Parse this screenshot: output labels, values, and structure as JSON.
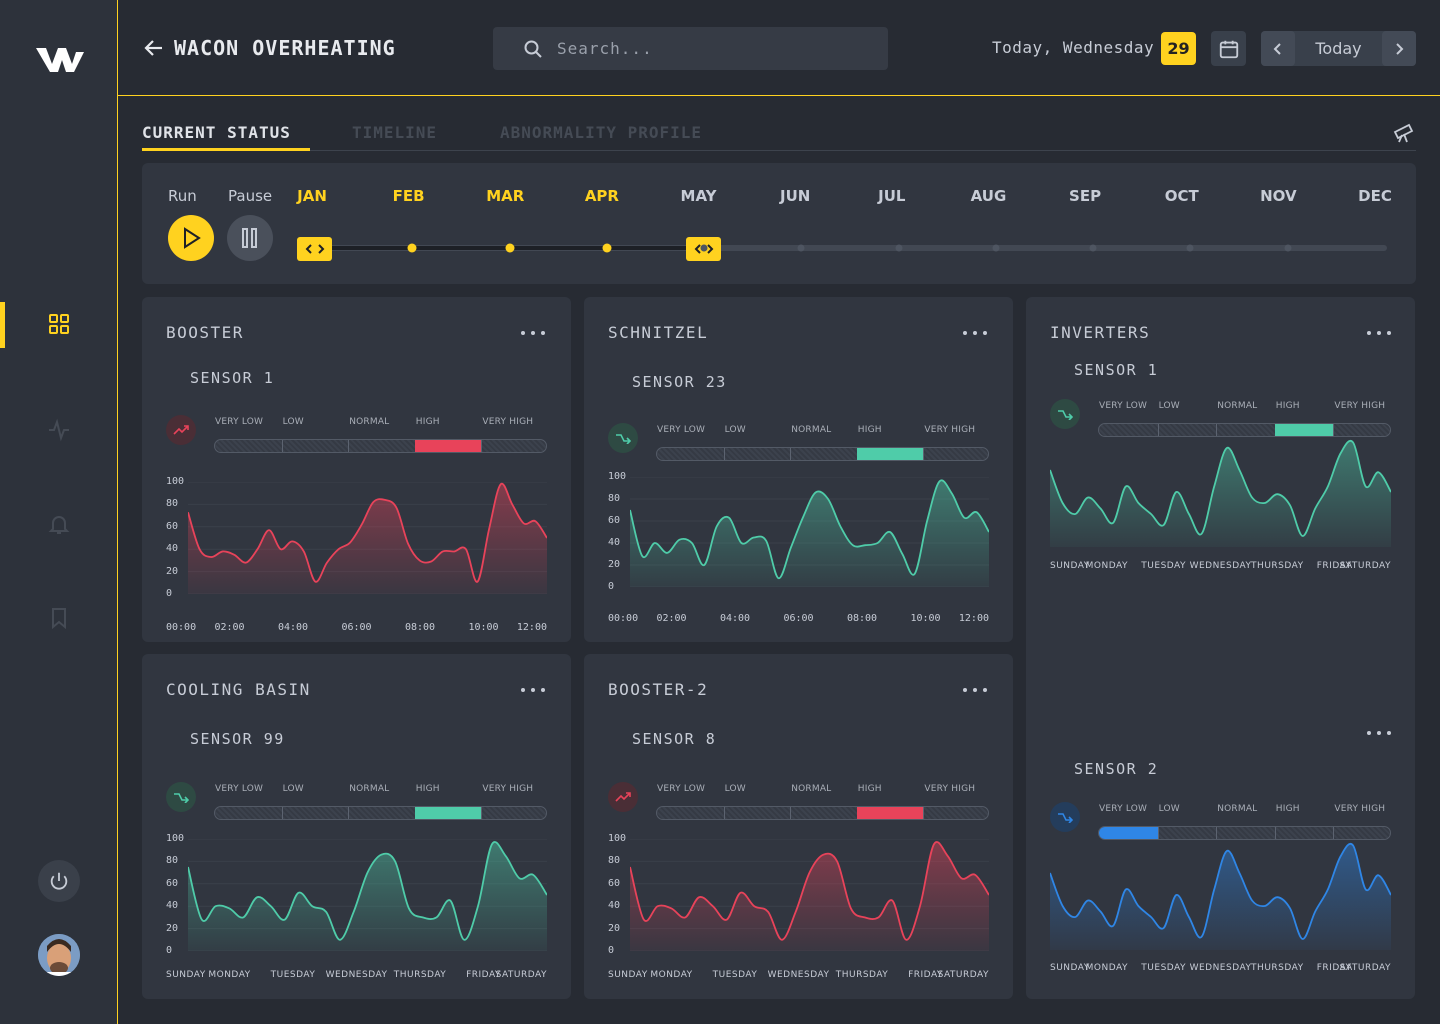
{
  "sidebar": {
    "active": "dashboard"
  },
  "header": {
    "title": "WACON OVERHEATING",
    "search_placeholder": "Search...",
    "today_text": "Today, Wednesday",
    "day_number": "29",
    "today_button": "Today"
  },
  "tabs": [
    {
      "label": "CURRENT STATUS",
      "active": true
    },
    {
      "label": "TIMELINE",
      "active": false
    },
    {
      "label": "ABNORMALITY PROFILE",
      "active": false
    }
  ],
  "timeline": {
    "run_label": "Run",
    "pause_label": "Pause",
    "months": [
      "JAN",
      "FEB",
      "MAR",
      "APR",
      "MAY",
      "JUN",
      "JUL",
      "AUG",
      "SEP",
      "OCT",
      "NOV",
      "DEC"
    ],
    "range_start": "JAN",
    "range_end": "APR"
  },
  "colors": {
    "accent": "#ffd21f",
    "red": "#e8435a",
    "green": "#4fcca9",
    "blue": "#2f86e6"
  },
  "scale_labels": [
    "VERY LOW",
    "LOW",
    "NORMAL",
    "HIGH",
    "VERY HIGH"
  ],
  "cards": [
    {
      "title": "BOOSTER",
      "sensor": "SENSOR 1",
      "level": "HIGH",
      "color": "red",
      "trend": "up",
      "chart_data": {
        "type": "area",
        "yticks": [
          "100",
          "80",
          "60",
          "40",
          "20",
          "0"
        ],
        "x": [
          "00:00",
          "02:00",
          "04:00",
          "06:00",
          "08:00",
          "10:00",
          "12:00"
        ],
        "values": [
          73,
          40,
          33,
          38,
          35,
          28,
          40,
          57,
          40,
          47,
          38,
          11,
          28,
          40,
          46,
          62,
          82,
          84,
          77,
          45,
          30,
          29,
          38,
          38,
          40,
          11,
          58,
          98,
          80,
          63,
          65,
          50
        ]
      }
    },
    {
      "title": "SCHNITZEL",
      "sensor": "SENSOR 23",
      "level": "HIGH",
      "color": "green",
      "trend": "down",
      "chart_data": {
        "type": "area",
        "yticks": [
          "100",
          "80",
          "60",
          "40",
          "20",
          "0"
        ],
        "x": [
          "00:00",
          "02:00",
          "04:00",
          "06:00",
          "08:00",
          "10:00",
          "12:00"
        ],
        "values": [
          70,
          28,
          40,
          31,
          43,
          40,
          20,
          55,
          63,
          40,
          45,
          42,
          8,
          36,
          64,
          86,
          80,
          55,
          38,
          38,
          40,
          50,
          30,
          12,
          60,
          96,
          85,
          63,
          68,
          50
        ]
      }
    },
    {
      "title": "INVERTERS",
      "sensor": "SENSOR 1",
      "level": "HIGH",
      "color": "green",
      "trend": "down",
      "chart_data": {
        "type": "area",
        "yticks": [],
        "x": [
          "SUNDAY",
          "MONDAY",
          "TUESDAY",
          "WEDNESDAY",
          "THURSDAY",
          "FRIDAY",
          "SATURDAY"
        ],
        "values": [
          70,
          40,
          30,
          45,
          35,
          22,
          55,
          40,
          30,
          20,
          50,
          30,
          12,
          55,
          90,
          70,
          45,
          40,
          48,
          38,
          10,
          35,
          55,
          85,
          95,
          55,
          68,
          50
        ]
      }
    },
    {
      "title": "COOLING BASIN",
      "sensor": "SENSOR 99",
      "level": "HIGH",
      "color": "green",
      "trend": "down",
      "chart_data": {
        "type": "area",
        "yticks": [
          "100",
          "80",
          "60",
          "40",
          "20",
          "0"
        ],
        "x": [
          "SUNDAY",
          "MONDAY",
          "TUESDAY",
          "WEDNESDAY",
          "THURSDAY",
          "FRIDAY",
          "SATURDAY"
        ],
        "values": [
          75,
          28,
          40,
          38,
          30,
          48,
          40,
          28,
          52,
          40,
          35,
          10,
          35,
          70,
          86,
          80,
          38,
          30,
          30,
          45,
          10,
          40,
          95,
          85,
          65,
          68,
          50
        ]
      }
    },
    {
      "title": "BOOSTER-2",
      "sensor": "SENSOR 8",
      "level": "HIGH",
      "color": "red",
      "trend": "up",
      "chart_data": {
        "type": "area",
        "yticks": [
          "100",
          "80",
          "60",
          "40",
          "20",
          "0"
        ],
        "x": [
          "SUNDAY",
          "MONDAY",
          "TUESDAY",
          "WEDNESDAY",
          "THURSDAY",
          "FRIDAY",
          "SATURDAY"
        ],
        "values": [
          75,
          28,
          40,
          38,
          30,
          48,
          40,
          28,
          52,
          40,
          35,
          10,
          35,
          70,
          86,
          80,
          38,
          30,
          30,
          45,
          10,
          40,
          95,
          85,
          65,
          68,
          50
        ]
      }
    },
    {
      "title": "",
      "sensor": "SENSOR 2",
      "level": "VERY LOW",
      "color": "blue",
      "trend": "down",
      "chart_data": {
        "type": "area",
        "yticks": [],
        "x": [
          "SUNDAY",
          "MONDAY",
          "TUESDAY",
          "WEDNESDAY",
          "THURSDAY",
          "FRIDAY",
          "SATURDAY"
        ],
        "values": [
          70,
          40,
          30,
          45,
          35,
          22,
          55,
          40,
          30,
          20,
          50,
          30,
          12,
          55,
          90,
          70,
          45,
          40,
          48,
          38,
          10,
          35,
          55,
          85,
          95,
          55,
          68,
          50
        ]
      }
    }
  ]
}
